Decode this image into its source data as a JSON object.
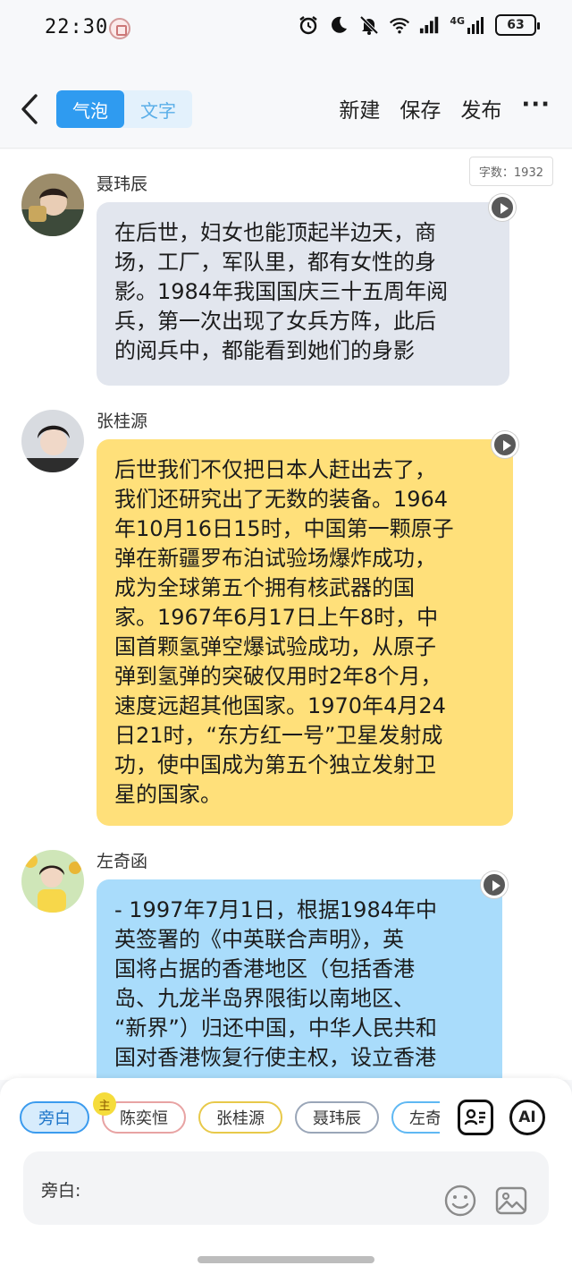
{
  "status_bar": {
    "time": "22:30",
    "icons": [
      "app-badge-icon",
      "alarm-icon",
      "moon-icon",
      "mute-bell-icon",
      "wifi-icon",
      "signal-icon"
    ],
    "network": "4G",
    "battery": "63"
  },
  "toolbar": {
    "tabs": [
      {
        "label": "气泡",
        "active": true
      },
      {
        "label": "文字",
        "active": false
      }
    ],
    "new_label": "新建",
    "save_label": "保存",
    "publish_label": "发布",
    "more_label": "···"
  },
  "word_count": "字数：1932",
  "messages": [
    {
      "speaker": "聂玮辰",
      "bubble_color": "#e2e6ee",
      "lines": [
        "在后世，妇女也能顶起半边天，商",
        "场，工厂，军队里，都有女性的身",
        "影。1984年我国国庆三十五周年阅",
        "兵，第一次出现了女兵方阵，此后",
        "的阅兵中，都能看到她们的身影"
      ]
    },
    {
      "speaker": "张桂源",
      "bubble_color": "#ffe07a",
      "lines": [
        "后世我们不仅把日本人赶出去了，",
        "我们还研究出了无数的装备。1964",
        "年10月16日15时，中国第一颗原子",
        "弹在新疆罗布泊试验场爆炸成功，",
        "成为全球第五个拥有核武器的国",
        "家。1967年6月17日上午8时，中",
        "国首颗氢弹空爆试验成功，从原子",
        "弹到氢弹的突破仅用时2年8个月，",
        "速度远超其他国家。1970年4月24",
        "日21时，“东方红一号”卫星发射成",
        "功，使中国成为第五个独立发射卫",
        "星的国家。"
      ]
    },
    {
      "speaker": "左奇函",
      "bubble_color": "#a9dcfb",
      "lines": [
        "- 1997年7月1日，根据1984年中",
        "英签署的《中英联合声明》，英",
        "国将占据的香港地区（包括香港",
        "岛、九龙半岛界限街以南地区、",
        "“新界”）归还中国，中华人民共和",
        "国对香港恢复行使主权，设立香港"
      ]
    }
  ],
  "characters": [
    {
      "name": "旁白",
      "active": true,
      "color": "#3b9bee"
    },
    {
      "name": "陈奕恒",
      "active": false,
      "color": "#e8a3a3"
    },
    {
      "name": "张桂源",
      "active": false,
      "color": "#e8c94a"
    },
    {
      "name": "聂玮辰",
      "active": false,
      "color": "#9aa6b8"
    },
    {
      "name": "左奇函",
      "active": false,
      "color": "#5fb8f3"
    }
  ],
  "lead_tag": "主",
  "tools": {
    "ai_label": "AI",
    "contacts_icon": "contact-card-icon"
  },
  "input": {
    "label": "旁白:",
    "emoji_icon": "smile-icon",
    "image_icon": "image-icon"
  }
}
